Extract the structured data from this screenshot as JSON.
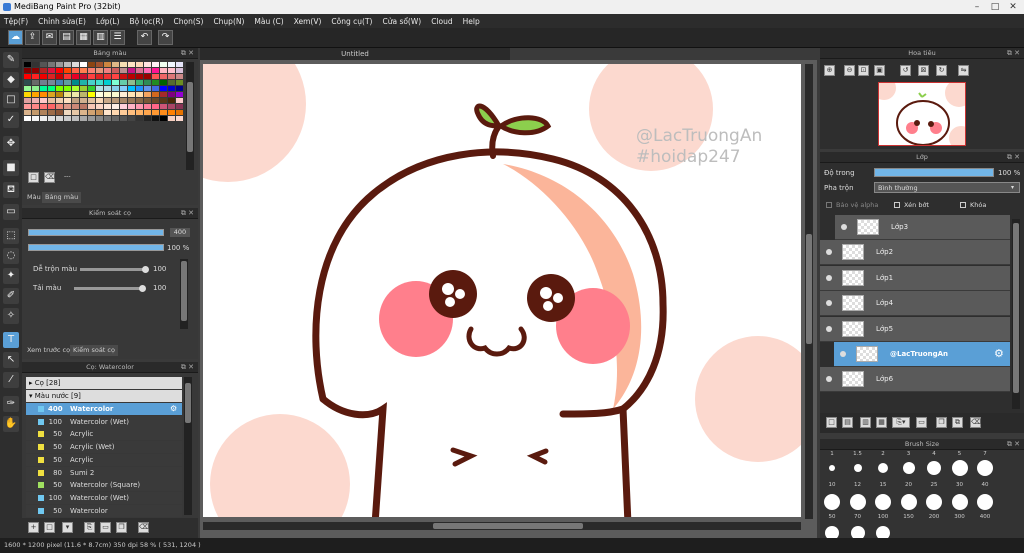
{
  "window": {
    "title": "MediBang Paint Pro (32bit)"
  },
  "menu": [
    "Tệp(F)",
    "Chỉnh sửa(E)",
    "Lớp(L)",
    "Bộ lọc(R)",
    "Chọn(S)",
    "Chụp(N)",
    "Màu (C)",
    "Xem(V)",
    "Công cụ(T)",
    "Cửa sổ(W)",
    "Cloud",
    "Help"
  ],
  "color_panel": {
    "title": "Bảng màu",
    "tabs": [
      "Màu",
      "Bảng màu"
    ],
    "extra": "---"
  },
  "brush_control": {
    "title": "Kiểm soát cọ",
    "size_value": "400",
    "opacity_value": "100 %",
    "blend_label": "Dễ trộn màu",
    "blend_value": "100",
    "reuse_label": "Tải màu",
    "reuse_value": "100",
    "tabs": [
      "Xem trước cọ",
      "Kiểm soát cọ"
    ]
  },
  "brush_panel": {
    "title": "Cọ: Watercolor",
    "groups": [
      {
        "label": "Cọ [28]"
      },
      {
        "label": "Màu nước [9]"
      }
    ],
    "items": [
      {
        "size": "400",
        "name": "Watercolor",
        "color": "#70c8f0"
      },
      {
        "size": "100",
        "name": "Watercolor (Wet)",
        "color": "#70c8f0"
      },
      {
        "size": "50",
        "name": "Acrylic",
        "color": "#f0e040"
      },
      {
        "size": "50",
        "name": "Acrylic (Wet)",
        "color": "#f0e040"
      },
      {
        "size": "50",
        "name": "Acrylic",
        "color": "#f0e040"
      },
      {
        "size": "80",
        "name": "Sumi 2",
        "color": "#f0e040"
      },
      {
        "size": "50",
        "name": "Watercolor (Square)",
        "color": "#a0e060"
      },
      {
        "size": "100",
        "name": "Watercolor (Wet)",
        "color": "#70c8f0"
      },
      {
        "size": "50",
        "name": "Watercolor",
        "color": "#70c8f0"
      }
    ]
  },
  "document": {
    "tab": "Untitled",
    "watermark_line1": "@LacTruongAn",
    "watermark_line2": "#hoidap247"
  },
  "navigator": {
    "title": "Hoa tiêu"
  },
  "layer_panel": {
    "title": "Lớp",
    "opacity_label": "Độ trong",
    "opacity_value": "100 %",
    "opacity_fraction": 1.0,
    "blend_label": "Pha trộn",
    "blend_value": "Bình thường",
    "check_alpha": "Bảo vệ alpha",
    "check_clip": "Xén bớt",
    "check_lock": "Khóa",
    "layers": [
      "Lớp3",
      "Lớp2",
      "Lớp1",
      "Lớp4",
      "Lớp5",
      "@LacTruongAn",
      "Lớp6"
    ],
    "selected_index": 5
  },
  "brush_size": {
    "title": "Brush Size",
    "top_ticks": [
      "1",
      "1.5",
      "2",
      "3",
      "4",
      "5",
      "7"
    ],
    "row1": [
      "10",
      "12",
      "15",
      "20",
      "25",
      "30",
      "40"
    ],
    "row2": [
      "50",
      "70",
      "100",
      "150",
      "200",
      "300",
      "400"
    ]
  },
  "status": {
    "text": "1600 * 1200 pixel   (11.6 * 8.7cm)   350 dpi   58 %   ( 531, 1204 )"
  },
  "colors": {
    "accent": "#5a9fd6",
    "outline": "#5a1a0e",
    "blush": "#ff7f8c",
    "bg_circle": "#fcd9cf"
  }
}
